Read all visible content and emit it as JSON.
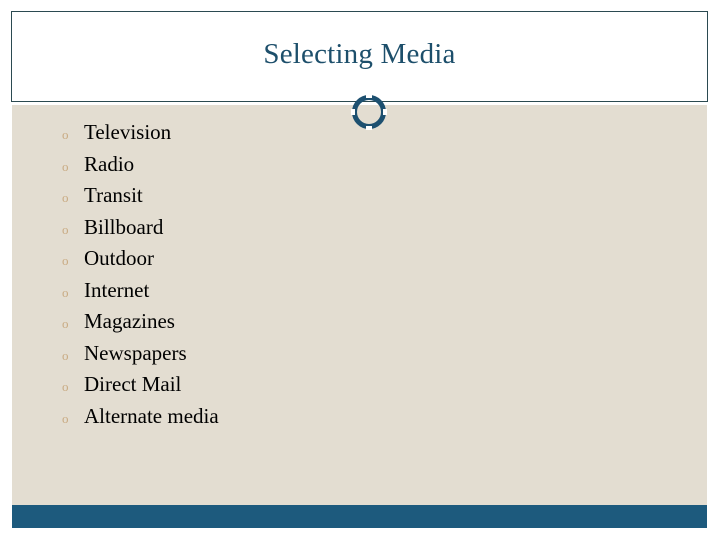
{
  "slide": {
    "title": "Selecting Media",
    "colors": {
      "title_text": "#1d4f6b",
      "header_border": "#2b4a51",
      "ring": "#1d5070",
      "body_background": "#e3ddd1",
      "footer_bar": "#1d5a7d",
      "bullet_marker": "#c9ab83",
      "body_text": "#000000",
      "page_background": "#ffffff"
    },
    "decoration": {
      "ring_icon": "ring-circle-icon",
      "divider": "header-divider-line"
    },
    "bullet_glyph": "o",
    "items": [
      {
        "label": "Television"
      },
      {
        "label": "Radio"
      },
      {
        "label": "Transit"
      },
      {
        "label": "Billboard"
      },
      {
        "label": "Outdoor"
      },
      {
        "label": "Internet"
      },
      {
        "label": "Magazines"
      },
      {
        "label": "Newspapers"
      },
      {
        "label": "Direct Mail"
      },
      {
        "label": "Alternate media"
      }
    ]
  }
}
